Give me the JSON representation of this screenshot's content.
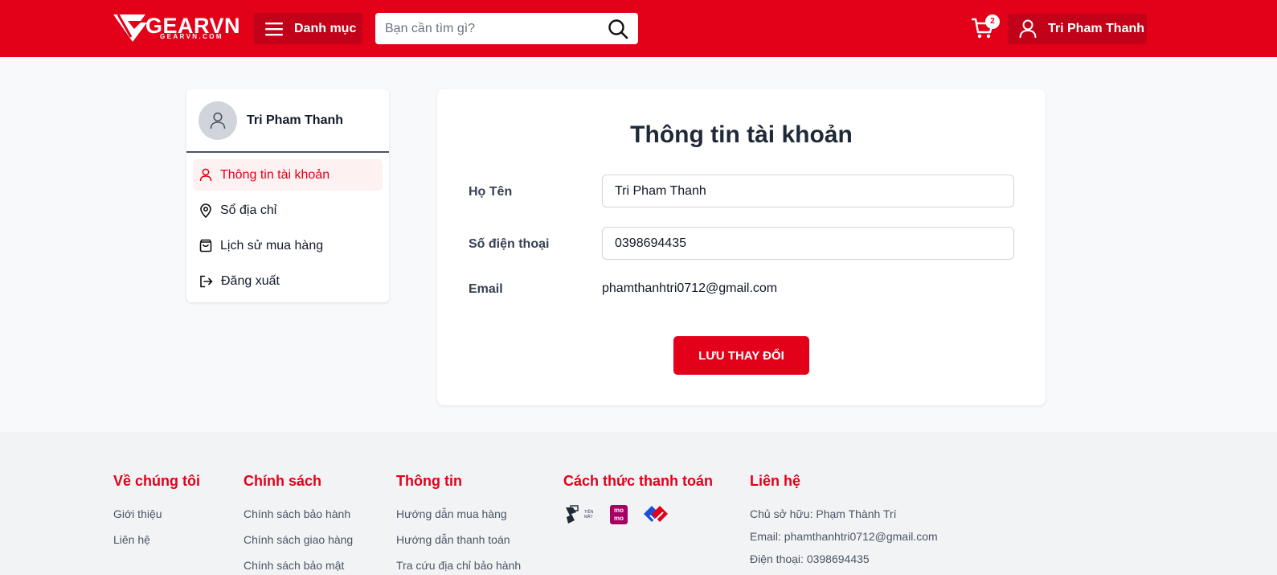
{
  "header": {
    "logo_text": "GEARVN",
    "logo_sub": "GEARVN.COM",
    "menu_label": "Danh mục",
    "search_placeholder": "Bạn cần tìm gì?",
    "cart_count": "2",
    "user_name": "Tri Pham Thanh",
    "brand_color": "#e30019"
  },
  "sidebar": {
    "profile_name": "Tri Pham Thanh",
    "items": [
      {
        "label": "Thông tin tài khoản",
        "icon": "user-icon",
        "active": true
      },
      {
        "label": "Sổ địa chỉ",
        "icon": "map-pin-icon",
        "active": false
      },
      {
        "label": "Lịch sử mua hàng",
        "icon": "shopping-bag-icon",
        "active": false
      },
      {
        "label": "Đăng xuất",
        "icon": "logout-icon",
        "active": false
      }
    ]
  },
  "account": {
    "title": "Thông tin tài khoản",
    "name_label": "Họ Tên",
    "name_value": "Tri Pham Thanh",
    "phone_label": "Số điện thoại",
    "phone_value": "0398694435",
    "email_label": "Email",
    "email_value": "phamthanhtri0712@gmail.com",
    "save_label": "LƯU THAY ĐỔI"
  },
  "footer": {
    "about": {
      "title": "Về chúng tôi",
      "links": [
        "Giới thiệu",
        "Liên hệ"
      ]
    },
    "policy": {
      "title": "Chính sách",
      "links": [
        "Chính sách bảo hành",
        "Chính sách giao hàng",
        "Chính sách bảo mật"
      ]
    },
    "info": {
      "title": "Thông tin",
      "links": [
        "Hướng dẫn mua hàng",
        "Hướng dẫn thanh toán",
        "Tra cứu địa chỉ bảo hành"
      ]
    },
    "payment": {
      "title": "Cách thức thanh toán",
      "methods": [
        "cash-icon",
        "momo-icon",
        "vnpay-icon"
      ],
      "cash_text": "TIỀN MẶT",
      "momo_text": "mo mo"
    },
    "contact": {
      "title": "Liên hệ",
      "lines": [
        "Chủ sở hữu: Phạm Thành Trí",
        "Email: phamthanhtri0712@gmail.com",
        "Điện thoại: 0398694435"
      ]
    }
  }
}
